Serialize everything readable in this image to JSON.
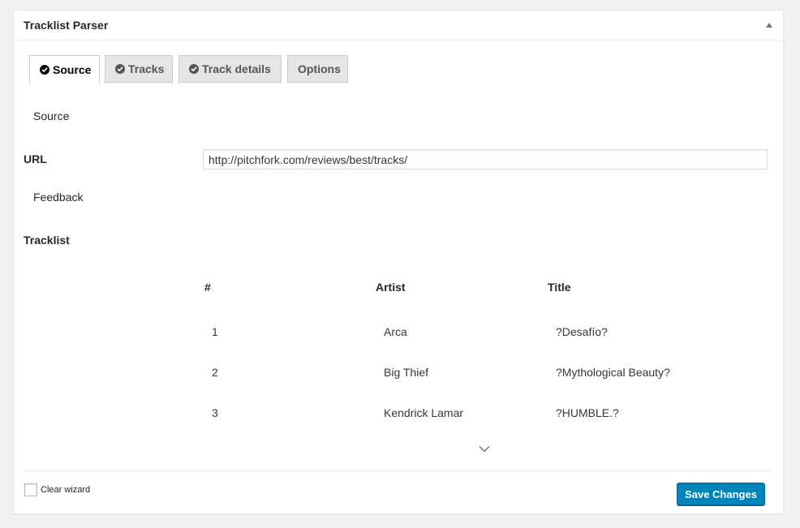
{
  "metabox": {
    "title": "Tracklist Parser"
  },
  "tabs": [
    {
      "label": "Source",
      "active": true
    },
    {
      "label": "Tracks",
      "active": false
    },
    {
      "label": "Track details",
      "active": false
    },
    {
      "label": "Options",
      "active": false
    }
  ],
  "source_section": {
    "heading": "Source",
    "url_label": "URL",
    "url_value": "http://pitchfork.com/reviews/best/tracks/",
    "feedback_label": "Feedback",
    "tracklist_label": "Tracklist"
  },
  "tracklist": {
    "columns": [
      "#",
      "Artist",
      "Title"
    ],
    "rows": [
      {
        "num": "1",
        "artist": "Arca",
        "title": "?Desafío?"
      },
      {
        "num": "2",
        "artist": "Big Thief",
        "title": "?Mythological Beauty?"
      },
      {
        "num": "3",
        "artist": "Kendrick Lamar",
        "title": "?HUMBLE.?"
      }
    ]
  },
  "footer": {
    "clear_wizard_label": "Clear wizard",
    "save_label": "Save Changes"
  },
  "colors": {
    "primary_button": "#0085ba",
    "background": "#f1f1f1"
  },
  "icons": [
    "check-circle-icon",
    "chevron-down-icon",
    "collapse-arrow-icon"
  ]
}
